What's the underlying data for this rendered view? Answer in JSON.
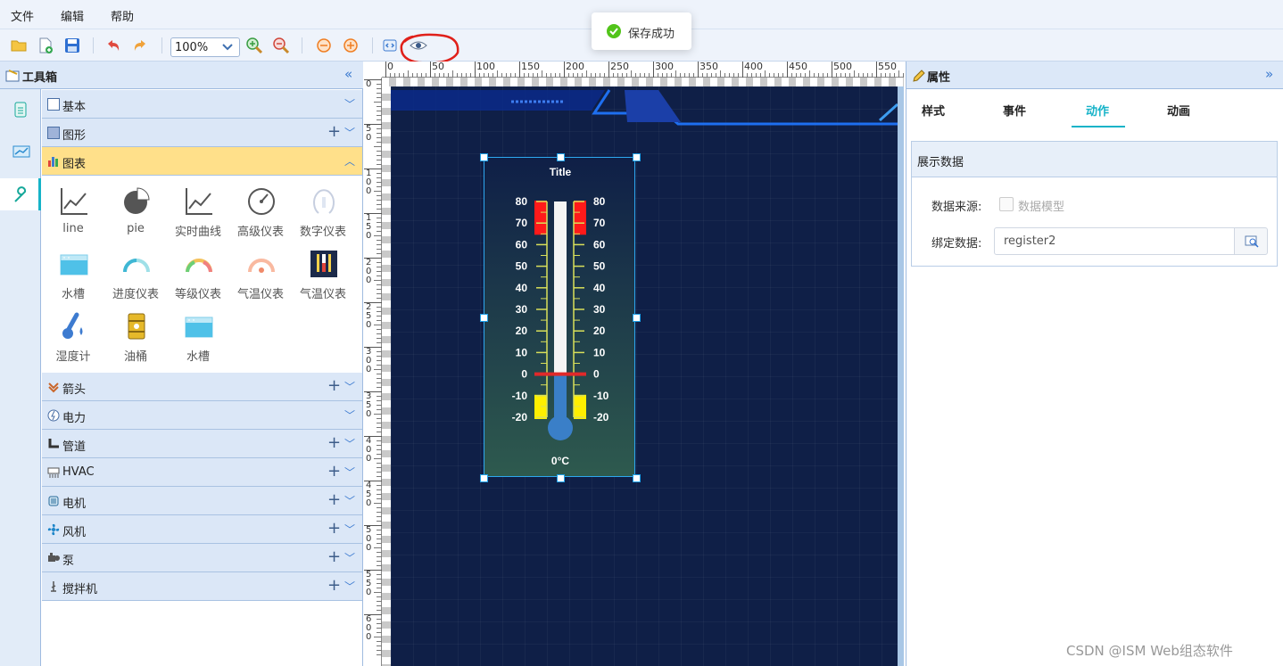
{
  "menu": {
    "file": "文件",
    "edit": "编辑",
    "help": "帮助"
  },
  "toolbar": {
    "zoom": "100%"
  },
  "toast": {
    "message": "保存成功"
  },
  "toolbox": {
    "title": "工具箱",
    "categories": {
      "basic": "基本",
      "shape": "图形",
      "chart": "图表",
      "arrow": "箭头",
      "power": "电力",
      "pipe": "管道",
      "hvac": "HVAC",
      "motor": "电机",
      "fan": "风机",
      "pump": "泵",
      "mixer": "搅拌机"
    },
    "chart_tools": [
      "line",
      "pie",
      "实时曲线",
      "高级仪表",
      "数字仪表",
      "水槽",
      "进度仪表",
      "等级仪表",
      "气温仪表",
      "气温仪表",
      "湿度计",
      "油桶",
      "水槽"
    ]
  },
  "ruler": {
    "top": [
      "0",
      "50",
      "100",
      "150",
      "200",
      "250",
      "300",
      "350",
      "400",
      "450",
      "500",
      "550"
    ],
    "left": [
      "0",
      "50",
      "100",
      "150",
      "200",
      "250",
      "300",
      "350",
      "400",
      "450",
      "500",
      "550",
      "600"
    ]
  },
  "widget": {
    "title": "Title",
    "scale": [
      "80",
      "70",
      "60",
      "50",
      "40",
      "30",
      "20",
      "10",
      "0",
      "-10",
      "-20"
    ],
    "readout": "0°C",
    "value": 0,
    "min": -20,
    "max": 80
  },
  "properties": {
    "title": "属性",
    "tabs": [
      "样式",
      "事件",
      "动作",
      "动画"
    ],
    "active_tab": "动作",
    "section_title": "展示数据",
    "data_source_label": "数据来源:",
    "data_model_label": "数据模型",
    "bind_label": "绑定数据:",
    "bind_value": "register2"
  },
  "watermark": "CSDN @ISM Web组态软件"
}
